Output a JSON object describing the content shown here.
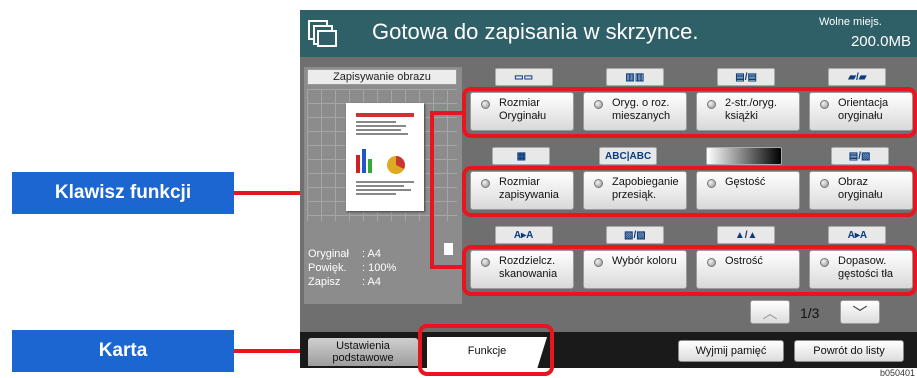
{
  "callouts": {
    "function_key": "Klawisz funkcji",
    "tab": "Karta"
  },
  "header": {
    "title": "Gotowa do zapisania w skrzynce.",
    "free_label": "Wolne miejs.",
    "free_value": "200.0MB"
  },
  "preview": {
    "title": "Zapisywanie obrazu",
    "info": [
      {
        "key": "Oryginał",
        "value": ": A4"
      },
      {
        "key": "Powięk.",
        "value": ": 100%"
      },
      {
        "key": "Zapisz",
        "value": ": A4"
      }
    ]
  },
  "thumb_labels": {
    "mixed": "ABC|ABC",
    "orient_a": "A",
    "orient_b": "A"
  },
  "functions": {
    "row1": [
      "Rozmiar Oryginału",
      "Oryg. o roz. mieszanych",
      "2-str./oryg. książki",
      "Orientacja oryginału"
    ],
    "row2": [
      "Rozmiar zapisywania",
      "Zapobieganie przesiąk.",
      "Gęstość",
      "Obraz oryginału"
    ],
    "row3": [
      "Rozdzielcz. skanowania",
      "Wybór koloru",
      "Ostrość",
      "Dopasow. gęstości tła"
    ]
  },
  "pager": {
    "text": "1/3"
  },
  "tabs": {
    "basic": "Ustawienia podstawowe",
    "functions": "Funkcje"
  },
  "bottom_buttons": {
    "eject": "Wyjmij pamięć",
    "back": "Powrót do listy"
  },
  "image_code": "b050401",
  "colors": {
    "header": "#2f5f67",
    "callout": "#1b66d1",
    "highlight": "#e8141e"
  }
}
